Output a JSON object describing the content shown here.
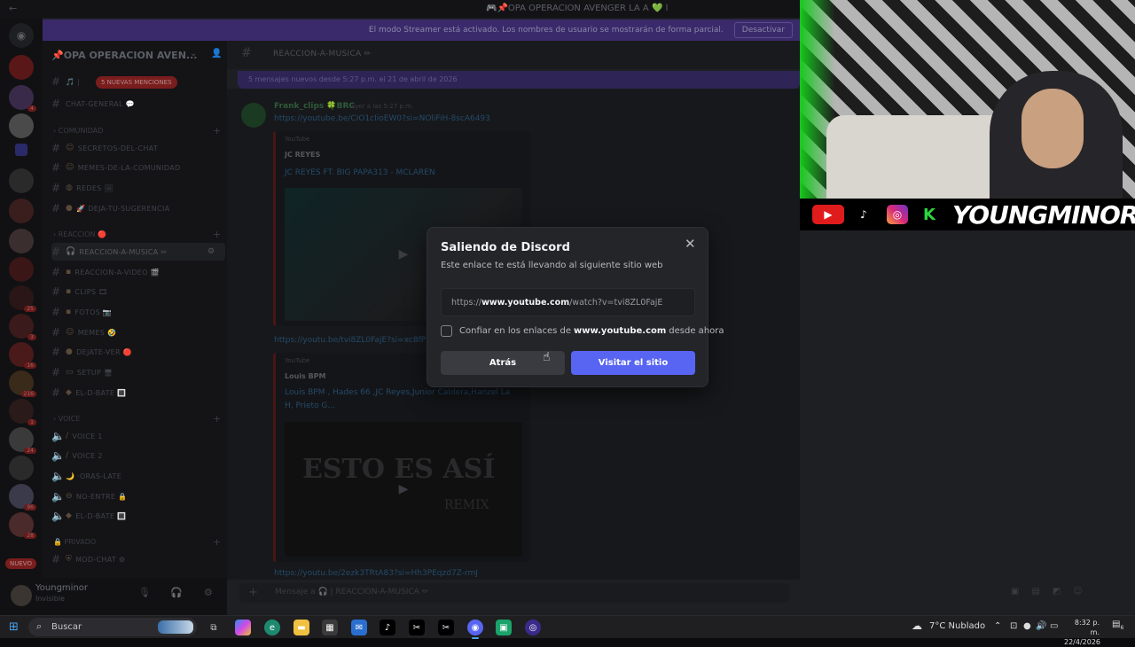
{
  "window": {
    "title": "🎮📌OPA OPERACION AVENGER LA A 💚 l"
  },
  "streamer_banner": {
    "message": "El modo Streamer está activado. Los nombres de usuario se mostrarán de forma parcial.",
    "button": "Desactivar"
  },
  "rail": {
    "badges": [
      "4",
      "",
      "",
      "",
      "",
      "",
      "",
      "",
      "",
      "25",
      "3",
      "16",
      "216",
      "1",
      "24",
      "",
      "96",
      "28",
      ""
    ],
    "new_label": "NUEVO"
  },
  "sidebar": {
    "server_name": "📌OPA OPERACION AVEN...",
    "mentions_badge": "5 NUEVAS MENCIONES",
    "channels_top": [
      {
        "name": "🎵 |"
      },
      {
        "name": "CHAT-GENERAL 💬"
      }
    ],
    "categories": [
      {
        "label": "COMUNIDAD"
      },
      {
        "label": "REACCION 🔴"
      },
      {
        "label": "VOICE"
      },
      {
        "label": "PRIVADO"
      }
    ],
    "comunidad": [
      "SECRETOS-DEL-CHAT",
      "MEMES-DE-LA-COMUNIDAD",
      "REDES 🖼",
      "🚀 DEJA-TU-SUGERENCIA"
    ],
    "reaccion": [
      "REACCION-A-MUSICA ✏",
      "REACCION-A-VIDEO 🎬",
      "CLIPS 🎞",
      "FOTOS 📷",
      "MEMES 🤣",
      "DEJATE-VER 🔴",
      "SETUP 🖥",
      "EL-D-BATE 🔳"
    ],
    "voice": [
      "VOICE 1",
      "VOICE 2",
      "🌙 ·ORAS-LATE",
      "NO-ENTRE 🔒",
      "EL-D-BATE 🔳"
    ],
    "privado": [
      "MOD-CHAT ⚙"
    ]
  },
  "user_panel": {
    "name": "Youngminor",
    "status": "Invisible"
  },
  "chat": {
    "channel_name": "REACCION-A-MUSICA ✏",
    "new_messages_bar": "5 mensajes nuevos desde 5:27 p.m. el 21 de abril de 2026",
    "author": "Frank_clips 🍀BRC",
    "timestamp": "ayer a las 5:27 p.m.",
    "link1": "https://youtube.be/CIO1cIioEW0?si=NOliFiH-8scA6493",
    "embed1": {
      "provider": "YouTube",
      "channel": "JC REYES",
      "title": "JC REYES FT. BIG PAPA313 - MCLAREN"
    },
    "link2": "https://youtu.be/tvi8ZL0FajE?si=xc8fP",
    "embed2": {
      "provider": "YouTube",
      "channel": "Louis BPM",
      "title": "Louis BPM , Hades 66 ,JC Reyes,Junior Caldera,Hanzel La H, Prieto G...",
      "thumb_text": "ESTO ES ASÍ",
      "thumb_sub": "REMIX"
    },
    "link3": "https://youtu.be/2ezk3TRtA83?si=Hh3PEqzd7Z-rmJ",
    "composer_placeholder": "Mensaje a 🎧 | REACCION-A-MUSICA ✏"
  },
  "webcam": {
    "brand": "YOUNGMINOR"
  },
  "modal": {
    "title": "Saliendo de Discord",
    "subtitle": "Este enlace te está llevando al siguiente sitio web",
    "url_prefix": "https://",
    "url_domain": "www.youtube.com",
    "url_path": "/watch?v=tvi8ZL0FajE",
    "trust_prefix": "Confiar en los enlaces de",
    "trust_domain": "www.youtube.com",
    "trust_suffix": "desde ahora",
    "back_button": "Atrás",
    "visit_button": "Visitar el sitio"
  },
  "taskbar": {
    "search_label": "Buscar",
    "weather": "7°C  Nublado",
    "time": "8:32 p. m.",
    "date": "22/4/2026",
    "notif_count": "6"
  },
  "colors": {
    "accent": "#5865f2",
    "modal_bg": "#242529",
    "streamer_banner": "#3b2a6b",
    "kick_green": "#2bd640",
    "youtube_red": "#e01b1b"
  }
}
